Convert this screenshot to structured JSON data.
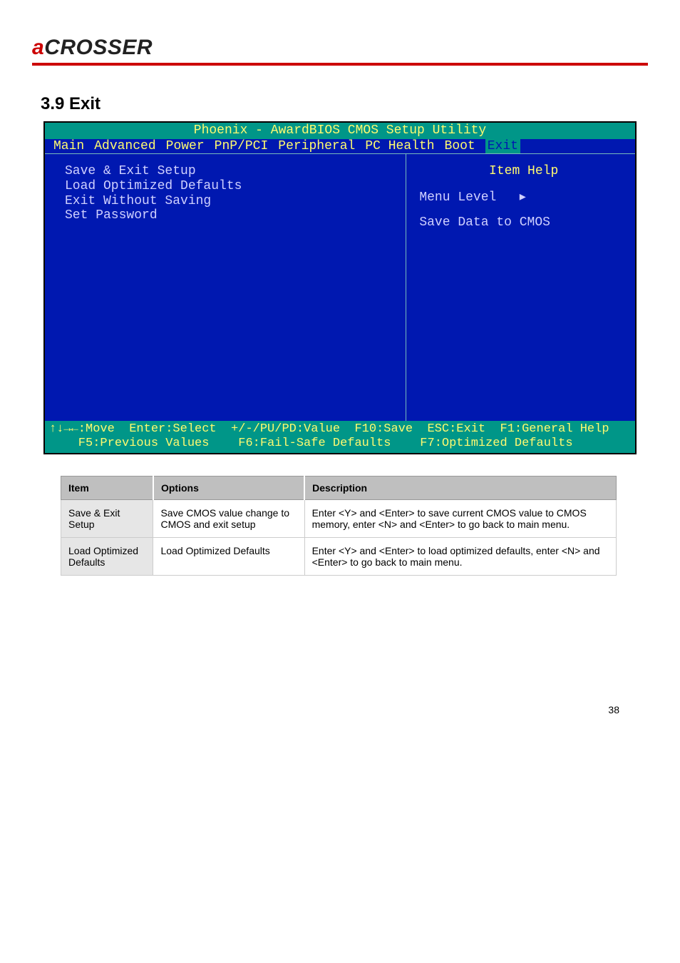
{
  "logo": {
    "accent": "a",
    "rest": "CROSSER"
  },
  "section_title": "3.9 Exit",
  "bios": {
    "title": "Phoenix - AwardBIOS CMOS Setup Utility",
    "menu": [
      "Main",
      "Advanced",
      "Power",
      "PnP/PCI",
      "Peripheral",
      "PC Health",
      "Boot",
      "Exit"
    ],
    "selected_menu_index": 7,
    "left_items": [
      "Save & Exit Setup",
      "Load Optimized Defaults",
      "Exit Without Saving",
      "Set Password"
    ],
    "help": {
      "title": "Item Help",
      "menu_level_label": "Menu Level",
      "menu_level_arrow": "▸",
      "text": "Save Data to CMOS"
    },
    "footer_line1": "↑↓→←:Move  Enter:Select  +/-/PU/PD:Value  F10:Save  ESC:Exit  F1:General Help",
    "footer_line2": "    F5:Previous Values    F6:Fail-Safe Defaults    F7:Optimized Defaults"
  },
  "table": {
    "headers": [
      "Item",
      "Options",
      "Description"
    ],
    "rows": [
      {
        "item": "Save & Exit Setup",
        "options": "Save CMOS value change to CMOS and exit setup",
        "description": "Enter <Y> and <Enter> to save current CMOS value to CMOS memory, enter <N> and <Enter> to go back to main menu."
      },
      {
        "item": "Load Optimized Defaults",
        "options": "Load Optimized Defaults",
        "description": "Enter <Y> and <Enter> to load optimized defaults, enter <N> and <Enter> to go back to main menu."
      }
    ]
  },
  "page_number": "38"
}
